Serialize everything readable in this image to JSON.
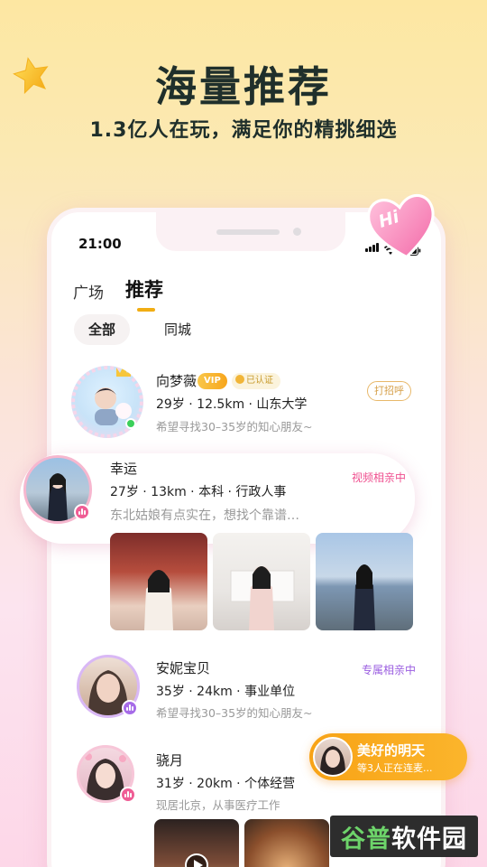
{
  "promo": {
    "headline": "海量推荐",
    "subline": "1.3亿人在玩，满足你的精挑细选",
    "heart_text": "Hi"
  },
  "phone": {
    "time": "21:00",
    "tabs": [
      {
        "label": "广场"
      },
      {
        "label": "推荐"
      }
    ],
    "filters": [
      {
        "label": "全部"
      },
      {
        "label": "同城"
      }
    ]
  },
  "users": [
    {
      "name": "向梦薇",
      "vip": "VIP",
      "cert": "已认证",
      "meta": "29岁 · 12.5km · 山东大学",
      "desc": "希望寻找30–35岁的知心朋友~",
      "action": "打招呼"
    },
    {
      "name": "幸运",
      "meta": "27岁 · 13km · 本科 · 行政人事",
      "desc": "东北姑娘有点实在，想找个靠谱…",
      "status": "视频相亲中"
    },
    {
      "name": "安妮宝贝",
      "meta": "35岁 · 24km · 事业单位",
      "desc": "希望寻找30–35岁的知心朋友~",
      "status": "专属相亲中"
    },
    {
      "name": "骁月",
      "meta": "31岁 · 20km · 个体经营",
      "desc": "现居北京，从事医疗工作"
    }
  ],
  "floating": {
    "name": "美好的明天",
    "sub": "等3人正在连麦..."
  },
  "watermark": {
    "part1": "谷普",
    "part2": "软件园"
  },
  "colors": {
    "accent": "#f1ad13",
    "pink_status": "#ef4f8f",
    "purple_status": "#9a5de0"
  }
}
